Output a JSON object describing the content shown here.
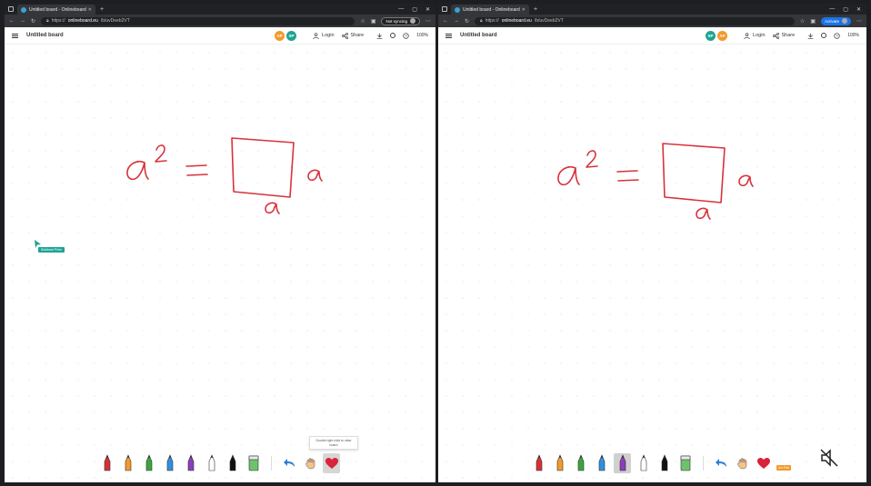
{
  "left": {
    "tab_title": "Untitled board - Onlineboard",
    "url_prefix": "https://",
    "url_domain": "onlineboard.eu",
    "url_path": "/b/uvDeeb2VT",
    "sync_label": "Not syncing",
    "board_title": "Untitled board",
    "avatars": [
      "AP",
      "SP"
    ],
    "login_label": "Login",
    "share_label": "Share",
    "zoom": "100%",
    "cursor_name": "Siddhant Pinto",
    "tooltip": "Double right click to clear board"
  },
  "right": {
    "tab_title": "Untitled board - Onlineboard",
    "url_prefix": "https://",
    "url_domain": "onlineboard.eu",
    "url_path": "/b/uvDeeb2VT",
    "activate_label": "Activate",
    "board_title": "Untitled board",
    "avatars": [
      "SP",
      "AP"
    ],
    "login_label": "Login",
    "share_label": "Share",
    "zoom": "100%",
    "cursor_name": "Ani Pali"
  },
  "pen_colors": [
    "#d62f3a",
    "#f39a2b",
    "#3aa63a",
    "#2f8fe0",
    "#8a3fb8",
    "#ffffff",
    "#111111"
  ],
  "ink_color": "#d8323c",
  "icons": [
    "pen-icon",
    "eraser-icon",
    "undo-icon",
    "hand-icon",
    "heart-icon",
    "mute-icon"
  ]
}
